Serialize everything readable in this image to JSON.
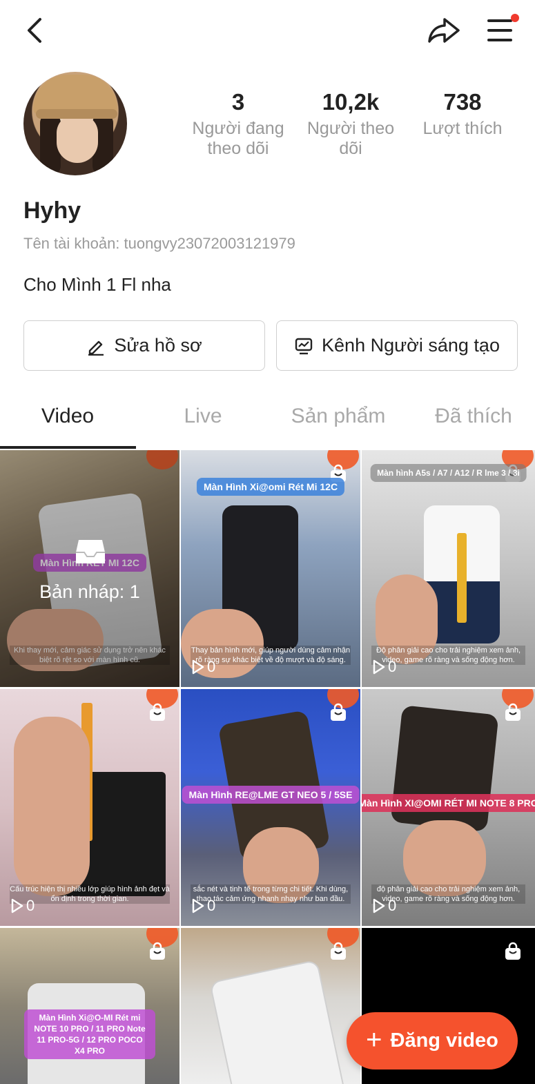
{
  "profile": {
    "name": "Hyhy",
    "account": "Tên tài khoản: tuongvy23072003121979",
    "bio": "Cho Mình 1 Fl nha"
  },
  "stats": [
    {
      "value": "3",
      "label_line1": "Người đang",
      "label_line2": "theo dõi"
    },
    {
      "value": "10,2k",
      "label_line1": "Người theo",
      "label_line2": "dõi"
    },
    {
      "value": "738",
      "label_line1": "Lượt thích",
      "label_line2": ""
    }
  ],
  "actions": {
    "edit_profile": "Sửa hồ sơ",
    "creator_channel": "Kênh Người sáng tạo"
  },
  "tabs": [
    "Video",
    "Live",
    "Sản phẩm",
    "Đã thích"
  ],
  "active_tab": "Video",
  "videos": [
    {
      "label": "Màn Hình RẾT MI 12C",
      "caption": "Khi thay mới, cảm giác sử dụng trở nên khác biệt rõ rệt so với màn hình cũ.",
      "views": "",
      "draft": "Bản nháp: 1"
    },
    {
      "label": "Màn Hình Xi@omi Rét Mi 12C",
      "caption": "Thay bản hình mới, giúp người dùng cảm nhận rõ ràng sự khác biệt về độ mượt và độ sáng.",
      "views": "0"
    },
    {
      "label": "Màn hình A5s / A7 / A12 / R lme 3 / 3i",
      "caption": "Độ phân giải cao cho trải nghiệm xem ảnh, video, game rõ ràng và sống động hơn.",
      "views": "0"
    },
    {
      "label": "",
      "caption": "Cấu trúc hiện thị nhiều lớp giúp hình ảnh đẹt và ổn định trong thời gian.",
      "views": "0"
    },
    {
      "label": "Màn Hình RE@LME GT NEO 5 / 5SE",
      "caption": "sắc nét và tinh tế trong từng chi tiết. Khi dùng, thao tác cảm ứng nhanh nhạy như ban đầu.",
      "views": "0"
    },
    {
      "label": "Màn Hình XI@OMI RÉT MI NOTE 8 PRO",
      "caption": "độ phân giải cao cho trải nghiệm xem ảnh, video, game rõ ràng và sống động hơn.",
      "views": "0"
    },
    {
      "label": "Màn Hình Xi@O-MI Rét mi NOTE 10 PRO / 11 PRO Note 11 PRO-5G / 12 PRO POCO X4 PRO",
      "caption": "",
      "views": ""
    },
    {
      "label": "",
      "caption": "",
      "views": ""
    },
    {
      "label": "",
      "caption": "",
      "views": ""
    }
  ],
  "post_button": "Đăng video",
  "colors": {
    "accent": "#f5522d",
    "notification_dot": "#f03a2e",
    "label_purple": "#be50d2"
  },
  "icons": [
    "back-arrow-icon",
    "share-icon",
    "menu-icon",
    "pencil-icon",
    "chart-icon",
    "shopping-bag-icon",
    "play-icon",
    "draft-tray-icon",
    "plus-icon"
  ]
}
